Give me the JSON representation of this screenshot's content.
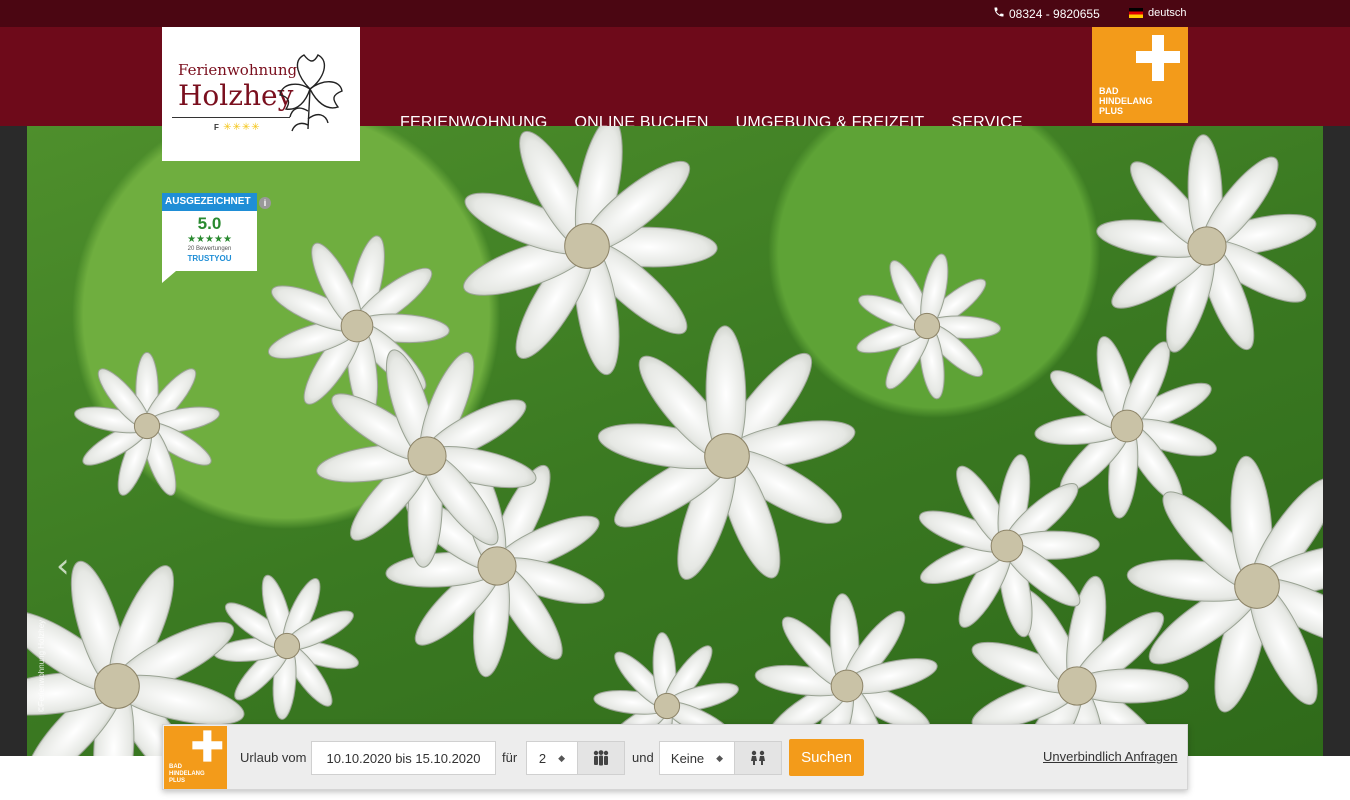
{
  "topbar": {
    "phone": "08324 - 9820655",
    "language": "deutsch"
  },
  "logo": {
    "line1": "Ferienwohnung",
    "line2": "Holzhey",
    "rating_prefix": "F",
    "rating_stars": "✳✳✳✳"
  },
  "nav": {
    "items": [
      {
        "label": "FERIENWOHNUNG"
      },
      {
        "label": "ONLINE BUCHEN"
      },
      {
        "label": "UMGEBUNG & FREIZEIT"
      },
      {
        "label": "SERVICE"
      }
    ]
  },
  "partner_badge": {
    "line1": "BAD",
    "line2": "HINDELANG",
    "line3": "PLUS"
  },
  "trust": {
    "badge": "AUSGEZEICHNET",
    "score": "5.0",
    "stars": "★★★★★",
    "count": "20 Bewertungen",
    "brand": "TRUSTYOU"
  },
  "hero": {
    "copyright": "©Ferienwohnung Holzhey",
    "slides": 7,
    "active_slide": 2
  },
  "booking": {
    "label_vacation": "Urlaub vom",
    "date_range": "10.10.2020 bis 15.10.2020",
    "label_for": "für",
    "adults": "2",
    "label_and": "und",
    "children": "Keine",
    "search_label": "Suchen",
    "inquire_label": "Unverbindlich Anfragen"
  },
  "colors": {
    "header": "#6e0a1a",
    "topbar": "#4b0612",
    "accent": "#f39b1a"
  }
}
